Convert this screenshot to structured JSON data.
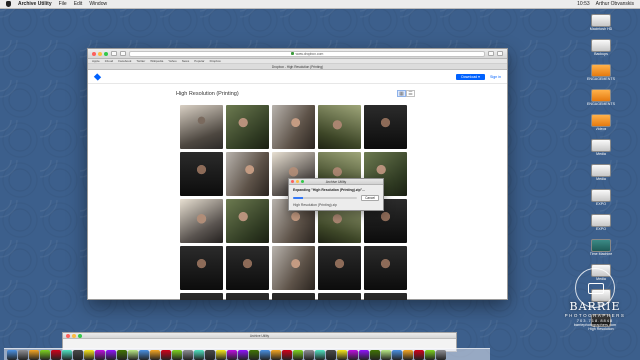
{
  "menubar": {
    "app_name": "Archive Utility",
    "items": [
      "File",
      "Edit",
      "Window"
    ],
    "clock": "10:53",
    "user": "Arthur Obvanskis"
  },
  "desktop_icons": [
    {
      "label": "Macintosh HD",
      "sub": "",
      "style": "silver"
    },
    {
      "label": "Backups",
      "sub": "",
      "style": "silver"
    },
    {
      "label": "ENGAGEMENTS",
      "sub": "",
      "style": "orange"
    },
    {
      "label": "ENGAGEMENTS",
      "sub": "",
      "style": "orange"
    },
    {
      "label": "Videos",
      "sub": "",
      "style": "orange"
    },
    {
      "label": "Media",
      "sub": "",
      "style": "silver"
    },
    {
      "label": "Media",
      "sub": "",
      "style": "silver"
    },
    {
      "label": "EXPO",
      "sub": "",
      "style": "silver"
    },
    {
      "label": "EXPO",
      "sub": "",
      "style": "silver"
    },
    {
      "label": "Time Machine",
      "sub": "",
      "style": "teal"
    },
    {
      "label": "Media",
      "sub": "",
      "style": "silver"
    },
    {
      "label": "SSD",
      "sub": "",
      "style": "silver"
    },
    {
      "label": "High Resolution",
      "sub": "",
      "style": "dark"
    }
  ],
  "browser": {
    "url": "www.dropbox.com",
    "tab_title": "Dropbox - High Resolution (Printing)",
    "bookmarks": [
      "Apple",
      "iCloud",
      "Facebook",
      "Twitter",
      "Wikipedia",
      "Yahoo",
      "News",
      "Popular",
      "Dropbox"
    ],
    "download_label": "Download ▾",
    "signin_label": "Sign in",
    "folder_title": "High Resolution (Printing)",
    "view_grid_glyph": "▦",
    "view_list_glyph": "☰"
  },
  "photos": [
    "t0",
    "t1",
    "t2",
    "t3",
    "t4",
    "t4",
    "t2",
    "t5",
    "t3",
    "t1",
    "t5",
    "t1",
    "t2",
    "t3",
    "t4",
    "t4",
    "t4",
    "t2",
    "t4",
    "t4",
    "t4",
    "t4",
    "t4",
    "t4",
    "t4"
  ],
  "dialog": {
    "title": "Archive Utility",
    "message": "Expanding \"High Resolution (Printing).zip\"...",
    "cancel_label": "Cancel",
    "subtext": "High Resolution (Printing).zip",
    "progress": 0.15,
    "accent_color": "#3478f6"
  },
  "bottom_window": {
    "title": "Archive Utility"
  },
  "dock_colors": [
    "#4a90e2",
    "#8e8e93",
    "#f5a623",
    "#7ed321",
    "#d0021b",
    "#50e3c2",
    "#4a4a4a",
    "#f8e71c",
    "#bd10e0",
    "#9013fe",
    "#417505",
    "#b8e986",
    "#4a90e2",
    "#f5a623",
    "#d0021b",
    "#7ed321",
    "#8e8e93",
    "#50e3c2",
    "#4a4a4a",
    "#f8e71c",
    "#bd10e0",
    "#9013fe",
    "#417505",
    "#4a90e2",
    "#f5a623",
    "#d0021b",
    "#7ed321",
    "#8e8e93",
    "#50e3c2",
    "#4a4a4a",
    "#f8e71c",
    "#bd10e0",
    "#9013fe",
    "#417505",
    "#b8e986",
    "#4a90e2",
    "#f5a623",
    "#d0021b",
    "#7ed321",
    "#8e8e93"
  ],
  "watermark": {
    "name": "BARRIE",
    "subtitle": "PHOTOGRAPHERS",
    "phone": "703.718.8848",
    "url": "barriephotographers.com"
  },
  "colors": {
    "brand": "#0061fe",
    "desktop": "#3c5f8c"
  }
}
